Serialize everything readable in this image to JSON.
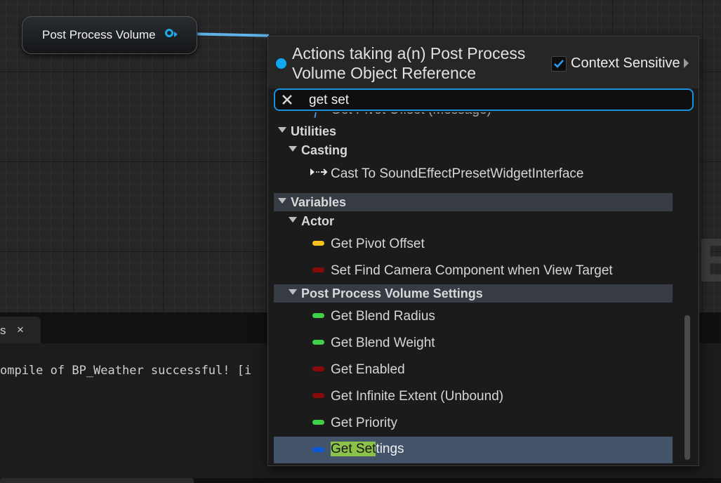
{
  "graph": {
    "node_label": "Post Process Volume",
    "background_letter": "E"
  },
  "log": {
    "tab_label": "s",
    "tab_close": "×",
    "line": "ompile of BP_Weather successful! [i"
  },
  "menu": {
    "title": "Actions taking a(n) Post Process Volume Object Reference",
    "context_sensitive_label": "Context Sensitive",
    "context_sensitive_checked": true,
    "search_value": "get set",
    "partial_item": "Get Pivot Offset (Message)",
    "categories": {
      "utilities": "Utilities",
      "casting": "Casting",
      "variables": "Variables",
      "actor": "Actor",
      "ppv_settings": "Post Process Volume Settings"
    },
    "items": {
      "cast": "Cast To SoundEffectPresetWidgetInterface",
      "get_pivot_offset": "Get Pivot Offset",
      "set_find_camera": "Set Find Camera Component when View Target",
      "get_blend_radius": "Get Blend Radius",
      "get_blend_weight": "Get Blend Weight",
      "get_enabled": "Get Enabled",
      "get_infinite_extent": "Get Infinite Extent (Unbound)",
      "get_priority": "Get Priority",
      "get_settings_match": "Get Set",
      "get_settings_rest": "tings"
    }
  },
  "colors": {
    "accent": "#1b8fdc",
    "pin_float": "#f7c21c",
    "pin_bool": "#8a0a0a",
    "pin_real": "#3fd14a",
    "pin_struct": "#0a58d6",
    "match_highlight": "#8bc34a",
    "selection": "#43536a"
  },
  "icons": {
    "node_pin": "object-pin-icon",
    "clear": "close-x-icon",
    "function": "function-icon",
    "cast": "cast-arrow-icon",
    "expand": "triangle-down-icon",
    "checkbox": "checkmark-icon",
    "menu": "triangle-right-icon"
  }
}
